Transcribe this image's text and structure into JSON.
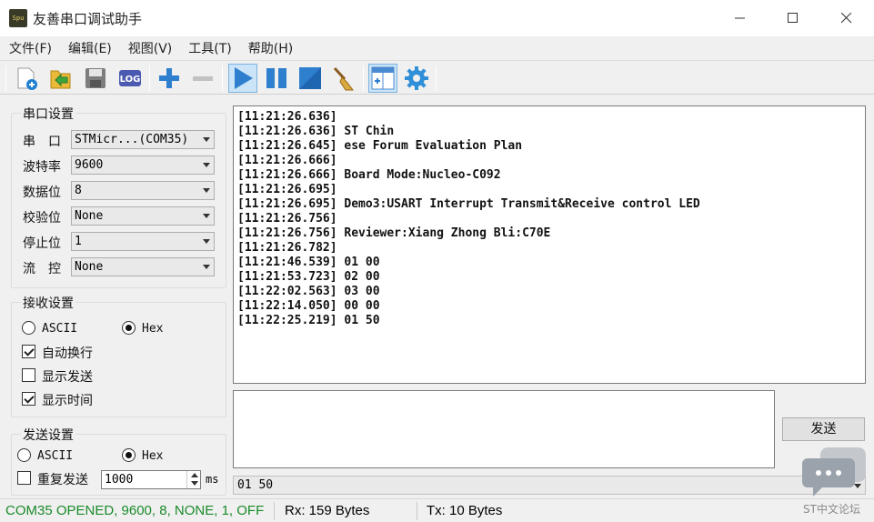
{
  "window": {
    "title": "友善串口调试助手",
    "icon_text": "Spu"
  },
  "menu": [
    "文件(F)",
    "编辑(E)",
    "视图(V)",
    "工具(T)",
    "帮助(H)"
  ],
  "toolbar": {
    "buttons": [
      "new-file-icon",
      "open-folder-icon",
      "save-icon",
      "log-icon",
      "add-icon",
      "remove-icon",
      "play-icon",
      "pause-icon",
      "stop-icon",
      "broom-icon",
      "layout-icon",
      "gear-icon"
    ],
    "log_label": "LOG"
  },
  "serial": {
    "title": "串口设置",
    "port_label": "串　口",
    "port_value": "STMicr...(COM35)",
    "baud_label": "波特率",
    "baud_value": "9600",
    "databits_label": "数据位",
    "databits_value": "8",
    "parity_label": "校验位",
    "parity_value": "None",
    "stopbits_label": "停止位",
    "stopbits_value": "1",
    "flow_label": "流　控",
    "flow_value": "None"
  },
  "receive": {
    "title": "接收设置",
    "ascii_label": "ASCII",
    "hex_label": "Hex",
    "mode": "hex",
    "autowrap_label": "自动换行",
    "autowrap": true,
    "showsend_label": "显示发送",
    "showsend": false,
    "showtime_label": "显示时间",
    "showtime": true
  },
  "send_settings": {
    "title": "发送设置",
    "ascii_label": "ASCII",
    "hex_label": "Hex",
    "mode": "hex",
    "repeat_label": "重复发送",
    "repeat": false,
    "interval_value": "1000",
    "interval_unit": "ms"
  },
  "log": [
    "[11:21:26.636]",
    "[11:21:26.636] ST Chin",
    "[11:21:26.645] ese Forum Evaluation Plan",
    "[11:21:26.666]",
    "[11:21:26.666] Board Mode:Nucleo-C092",
    "[11:21:26.695]",
    "[11:21:26.695] Demo3:USART Interrupt Transmit&Receive control LED",
    "[11:21:26.756]",
    "[11:21:26.756] Reviewer:Xiang Zhong Bli:C70E",
    "[11:21:26.782]",
    "[11:21:46.539] 01 00",
    "[11:21:53.723] 02 00",
    "[11:22:02.563] 03 00",
    "[11:22:14.050] 00 00",
    "[11:22:25.219] 01 50"
  ],
  "send": {
    "button_label": "发送",
    "text": "",
    "history_value": "01 50"
  },
  "status": {
    "port_state": "COM35 OPENED, 9600, 8, NONE, 1, OFF",
    "port_state_color": "#1a8a2a",
    "rx": "Rx: 159 Bytes",
    "tx": "Tx: 10 Bytes"
  },
  "watermark": {
    "text": "ST中文论坛"
  }
}
